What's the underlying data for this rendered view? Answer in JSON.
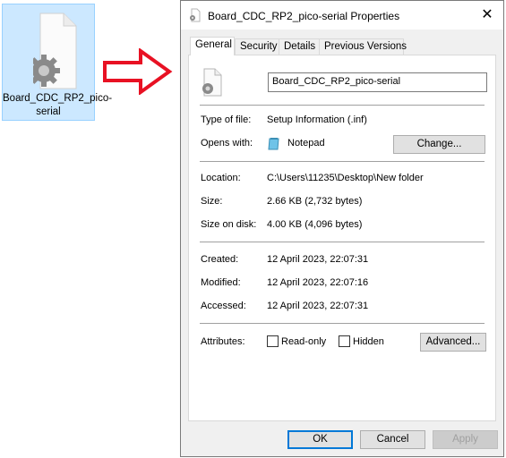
{
  "desktop": {
    "file_label": "Board_CDC_RP2_pico-serial"
  },
  "dialog": {
    "title": "Board_CDC_RP2_pico-serial Properties",
    "close_glyph": "✕",
    "tabs": [
      {
        "label": "General",
        "active": true
      },
      {
        "label": "Security"
      },
      {
        "label": "Details"
      },
      {
        "label": "Previous Versions"
      }
    ],
    "general": {
      "file_name": "Board_CDC_RP2_pico-serial",
      "type_label": "Type of file:",
      "type_value": "Setup Information (.inf)",
      "opens_label": "Opens with:",
      "opens_value": "Notepad",
      "change_button": "Change...",
      "location_label": "Location:",
      "location_value": "C:\\Users\\11235\\Desktop\\New folder",
      "size_label": "Size:",
      "size_value": "2.66 KB (2,732 bytes)",
      "size_disk_label": "Size on disk:",
      "size_disk_value": "4.00 KB (4,096 bytes)",
      "created_label": "Created:",
      "created_value": "12 April 2023, 22:07:31",
      "modified_label": "Modified:",
      "modified_value": "12 April 2023, 22:07:16",
      "accessed_label": "Accessed:",
      "accessed_value": "12 April 2023, 22:07:31",
      "attributes_label": "Attributes:",
      "readonly_label": "Read-only",
      "hidden_label": "Hidden",
      "advanced_button": "Advanced..."
    },
    "buttons": {
      "ok": "OK",
      "cancel": "Cancel",
      "apply": "Apply"
    }
  },
  "colors": {
    "selection_bg": "#cce8ff",
    "arrow_red": "#e81123",
    "default_button_border": "#0078d7"
  },
  "icons": [
    "settings-file-icon",
    "right-arrow-icon",
    "notepad-icon",
    "close-icon"
  ]
}
